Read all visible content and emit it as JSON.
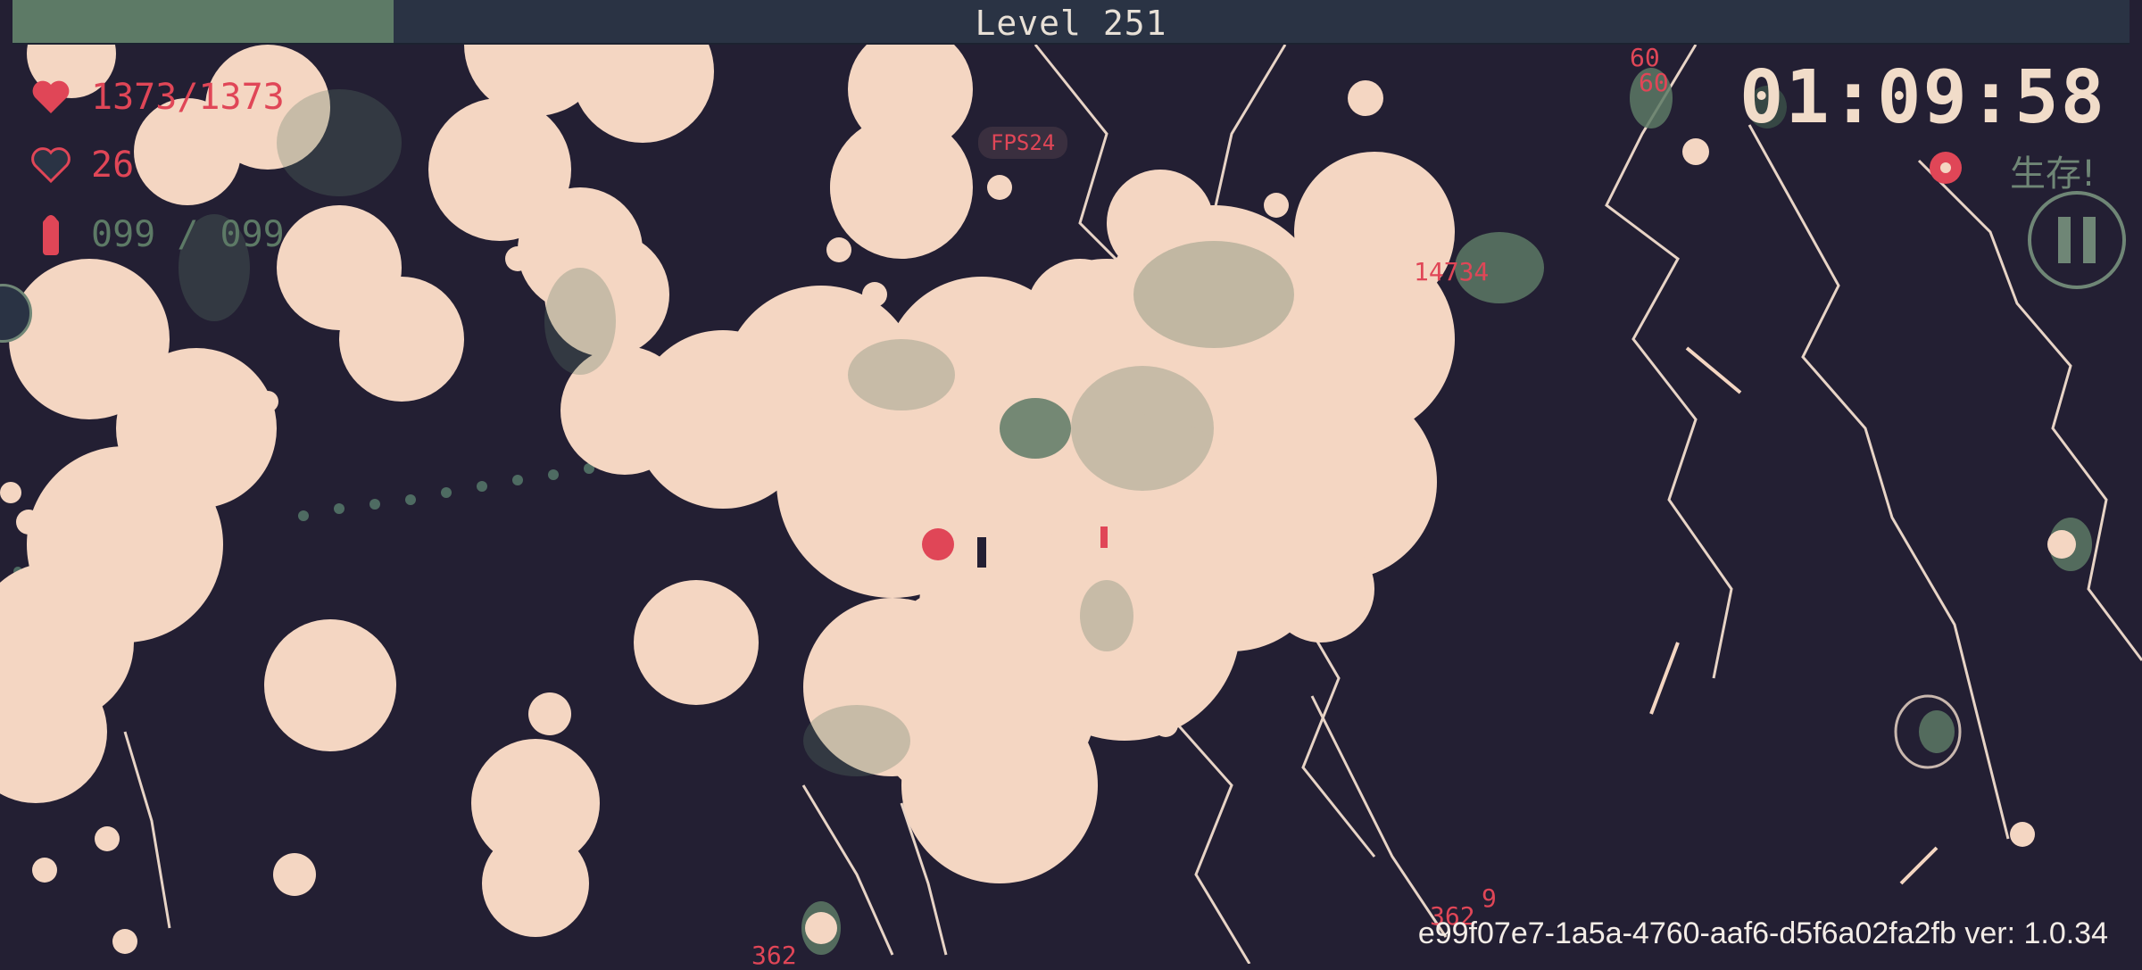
{
  "hud": {
    "level_label": "Level  251",
    "xp_progress": 0.18,
    "hp_text": "1373/1373",
    "armor_text": "26",
    "ammo_text": "099 / 099",
    "timer": "01:09:58",
    "survive_label": "生存!",
    "fps_label": "FPS24",
    "version_text": "e99f07e7-1a5a-4760-aaf6-d5f6a02fa2fb ver: 1.0.34"
  },
  "damage_numbers": [
    "60",
    "60",
    "14734",
    "9",
    "362",
    "362"
  ],
  "icons": {
    "hp": "heart-icon",
    "armor": "shield-heart-icon",
    "ammo": "bullet-icon",
    "pause": "pause-icon"
  },
  "colors": {
    "background": "#231f33",
    "blast": "#f4d6c2",
    "foliage": "#5d7a66",
    "accent_red": "#e04657",
    "xp_fill": "#5d7a66",
    "xp_track": "#2a3344"
  }
}
